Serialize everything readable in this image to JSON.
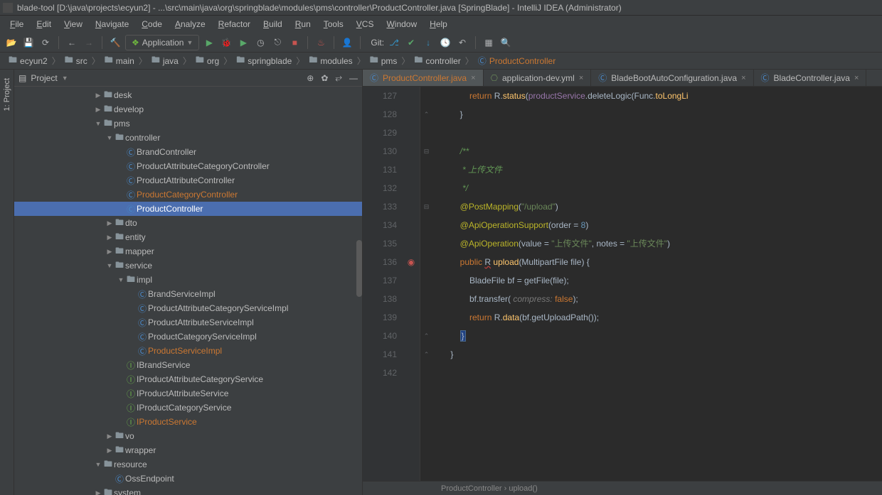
{
  "title": "blade-tool [D:\\java\\projects\\ecyun2] - ...\\src\\main\\java\\org\\springblade\\modules\\pms\\controller\\ProductController.java [SpringBlade] - IntelliJ IDEA (Administrator)",
  "menu": [
    "File",
    "Edit",
    "View",
    "Navigate",
    "Code",
    "Analyze",
    "Refactor",
    "Build",
    "Run",
    "Tools",
    "VCS",
    "Window",
    "Help"
  ],
  "run_config": "Application",
  "git_label": "Git:",
  "breadcrumbs": [
    "ecyun2",
    "src",
    "main",
    "java",
    "org",
    "springblade",
    "modules",
    "pms",
    "controller",
    "ProductController"
  ],
  "left_tab": "1: Project",
  "panel_title": "Project",
  "panel_icons": {
    "target": "⊕",
    "settings": "✿",
    "collapse": "⥂",
    "hide": "—"
  },
  "tree": [
    {
      "indent": 7,
      "arrow": "right",
      "icon": "folder",
      "label": "desk"
    },
    {
      "indent": 7,
      "arrow": "right",
      "icon": "folder",
      "label": "develop"
    },
    {
      "indent": 7,
      "arrow": "down",
      "icon": "folder",
      "label": "pms"
    },
    {
      "indent": 8,
      "arrow": "down",
      "icon": "folder",
      "label": "controller"
    },
    {
      "indent": 9,
      "arrow": "none",
      "icon": "class",
      "label": "BrandController"
    },
    {
      "indent": 9,
      "arrow": "none",
      "icon": "class",
      "label": "ProductAttributeCategoryController"
    },
    {
      "indent": 9,
      "arrow": "none",
      "icon": "class",
      "label": "ProductAttributeController"
    },
    {
      "indent": 9,
      "arrow": "none",
      "icon": "class",
      "label": "ProductCategoryController",
      "warn": true
    },
    {
      "indent": 9,
      "arrow": "none",
      "icon": "class",
      "label": "ProductController",
      "selected": true
    },
    {
      "indent": 8,
      "arrow": "right",
      "icon": "folder",
      "label": "dto"
    },
    {
      "indent": 8,
      "arrow": "right",
      "icon": "folder",
      "label": "entity"
    },
    {
      "indent": 8,
      "arrow": "right",
      "icon": "folder",
      "label": "mapper"
    },
    {
      "indent": 8,
      "arrow": "down",
      "icon": "folder",
      "label": "service"
    },
    {
      "indent": 9,
      "arrow": "down",
      "icon": "folder",
      "label": "impl"
    },
    {
      "indent": 10,
      "arrow": "none",
      "icon": "class",
      "label": "BrandServiceImpl"
    },
    {
      "indent": 10,
      "arrow": "none",
      "icon": "class",
      "label": "ProductAttributeCategoryServiceImpl"
    },
    {
      "indent": 10,
      "arrow": "none",
      "icon": "class",
      "label": "ProductAttributeServiceImpl"
    },
    {
      "indent": 10,
      "arrow": "none",
      "icon": "class",
      "label": "ProductCategoryServiceImpl"
    },
    {
      "indent": 10,
      "arrow": "none",
      "icon": "class",
      "label": "ProductServiceImpl",
      "warn": true
    },
    {
      "indent": 9,
      "arrow": "none",
      "icon": "iface",
      "label": "IBrandService"
    },
    {
      "indent": 9,
      "arrow": "none",
      "icon": "iface",
      "label": "IProductAttributeCategoryService"
    },
    {
      "indent": 9,
      "arrow": "none",
      "icon": "iface",
      "label": "IProductAttributeService"
    },
    {
      "indent": 9,
      "arrow": "none",
      "icon": "iface",
      "label": "IProductCategoryService"
    },
    {
      "indent": 9,
      "arrow": "none",
      "icon": "iface",
      "label": "IProductService",
      "warn": true
    },
    {
      "indent": 8,
      "arrow": "right",
      "icon": "folder",
      "label": "vo"
    },
    {
      "indent": 8,
      "arrow": "right",
      "icon": "folder",
      "label": "wrapper"
    },
    {
      "indent": 7,
      "arrow": "down",
      "icon": "folder",
      "label": "resource"
    },
    {
      "indent": 8,
      "arrow": "none",
      "icon": "class",
      "label": "OssEndpoint"
    },
    {
      "indent": 7,
      "arrow": "right",
      "icon": "folder",
      "label": "system"
    }
  ],
  "editor_tabs": [
    {
      "label": "ProductController.java",
      "active": true,
      "icon": "class"
    },
    {
      "label": "application-dev.yml",
      "active": false,
      "icon": "yaml"
    },
    {
      "label": "BladeBootAutoConfiguration.java",
      "active": false,
      "icon": "class"
    },
    {
      "label": "BladeController.java",
      "active": false,
      "icon": "class"
    }
  ],
  "line_start": 127,
  "line_end": 142,
  "code_lines": [
    {
      "n": 127,
      "html": "            <span class='kw'>return</span> R.<span class='method'>status</span>(<span class='field'>productService</span>.deleteLogic(Func.<span class='method'>toLongLi</span>"
    },
    {
      "n": 128,
      "html": "        }",
      "fold": "up"
    },
    {
      "n": 129,
      "html": ""
    },
    {
      "n": 130,
      "html": "        <span class='commdoc'>/**</span>",
      "fold": "minus"
    },
    {
      "n": 131,
      "html": "        <span class='commdoc'> * 上传文件</span>"
    },
    {
      "n": 132,
      "html": "        <span class='commdoc'> */</span>"
    },
    {
      "n": 133,
      "html": "        <span class='anno'>@PostMapping</span>(<span class='str'>\"/upload\"</span>)",
      "fold": "minus"
    },
    {
      "n": 134,
      "html": "        <span class='anno'>@ApiOperationSupport</span>(order = <span class='num'>8</span>)"
    },
    {
      "n": 135,
      "html": "        <span class='anno'>@ApiOperation</span>(value = <span class='str'>\"上传文件\"</span>, notes = <span class='str'>\"上传文件\"</span>)"
    },
    {
      "n": 136,
      "html": "        <span class='kw'>public</span> <span class='err'>R</span> <span class='method'>upload</span>(MultipartFile file) {",
      "gutter": "impl"
    },
    {
      "n": 137,
      "html": "            BladeFile bf = getFile(file);"
    },
    {
      "n": 138,
      "html": "            bf.transfer( <span class='hint'>compress:</span> <span class='kw'>false</span>);"
    },
    {
      "n": 139,
      "html": "            <span class='kw'>return</span> R.<span class='method'>data</span>(bf.getUploadPath());"
    },
    {
      "n": 140,
      "html": "        <span class='cursor-brace'>}</span>",
      "fold": "up"
    },
    {
      "n": 141,
      "html": "    }",
      "fold": "up"
    },
    {
      "n": 142,
      "html": ""
    }
  ],
  "status_breadcrumb": "ProductController  ›  upload()"
}
